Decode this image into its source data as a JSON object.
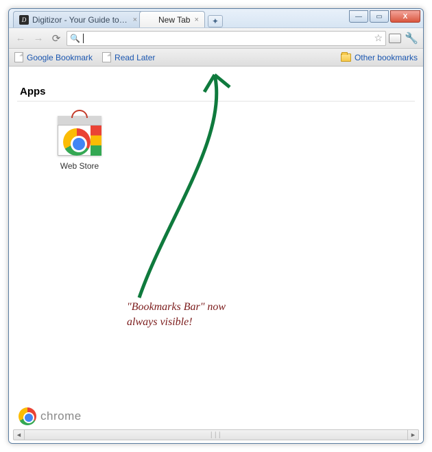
{
  "window": {
    "controls": {
      "minimize": "—",
      "maximize": "▭",
      "close": "X"
    }
  },
  "tabs": [
    {
      "label": "Digitizor - Your Guide to …",
      "favicon": "D",
      "active": false
    },
    {
      "label": "New Tab",
      "favicon": "",
      "active": true
    }
  ],
  "newtab_glyph": "✦",
  "toolbar": {
    "back": "←",
    "forward": "→",
    "reload": "⟳",
    "search_glyph": "🔍",
    "url_value": "",
    "star_glyph": "☆",
    "wrench_glyph": "🔧"
  },
  "bookmarks": {
    "items": [
      {
        "label": "Google Bookmark"
      },
      {
        "label": "Read Later"
      }
    ],
    "other_label": "Other bookmarks"
  },
  "content": {
    "apps_heading": "Apps",
    "app_tile_label": "Web Store",
    "annotation_line1": "\"Bookmarks Bar\" now",
    "annotation_line2": "always visible!",
    "footer_brand": "chrome"
  }
}
